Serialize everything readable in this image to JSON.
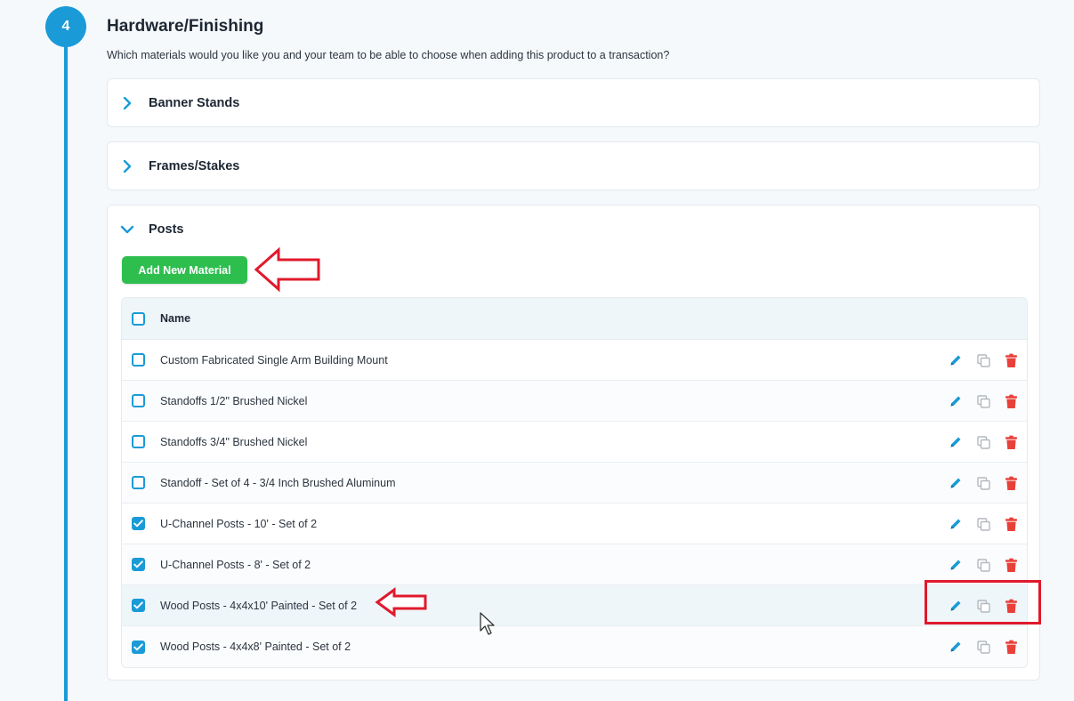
{
  "step": {
    "number": "4",
    "title": "Hardware/Finishing",
    "subtitle": "Which materials would you like you and your team to be able to choose when adding this product to a transaction?"
  },
  "accordions": [
    {
      "label": "Banner Stands",
      "expanded": false
    },
    {
      "label": "Frames/Stakes",
      "expanded": false
    },
    {
      "label": "Posts",
      "expanded": true
    }
  ],
  "posts": {
    "add_button_label": "Add New Material",
    "table": {
      "header": {
        "name": "Name"
      },
      "rows": [
        {
          "name": "Custom Fabricated Single Arm Building Mount",
          "checked": false
        },
        {
          "name": "Standoffs 1/2\" Brushed Nickel",
          "checked": false
        },
        {
          "name": "Standoffs 3/4\" Brushed Nickel",
          "checked": false
        },
        {
          "name": "Standoff - Set of 4 - 3/4 Inch Brushed Aluminum",
          "checked": false
        },
        {
          "name": "U-Channel Posts - 10' - Set of 2",
          "checked": true
        },
        {
          "name": "U-Channel Posts - 8' - Set of 2",
          "checked": true
        },
        {
          "name": "Wood Posts - 4x4x10' Painted - Set of 2",
          "checked": true
        },
        {
          "name": "Wood Posts - 4x4x8' Painted - Set of 2",
          "checked": true
        }
      ]
    }
  },
  "colors": {
    "primary": "#1a9bd7",
    "add_button": "#2dbe4e",
    "delete": "#e8413a",
    "annotation": "#e0192c"
  },
  "icons": {
    "edit": "pencil-icon",
    "copy": "copy-icon",
    "delete": "trash-icon",
    "collapsed": "chevron-right-icon",
    "expanded": "chevron-down-icon"
  }
}
